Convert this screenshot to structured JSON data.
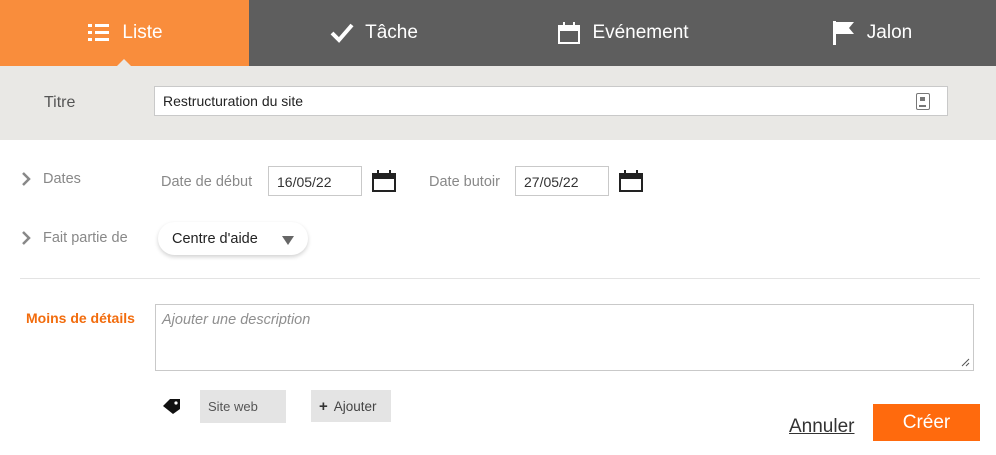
{
  "tabs": [
    {
      "label": "Liste",
      "icon": "list-icon",
      "active": true
    },
    {
      "label": "Tâche",
      "icon": "check-icon",
      "active": false
    },
    {
      "label": "Evénement",
      "icon": "calendar-icon",
      "active": false
    },
    {
      "label": "Jalon",
      "icon": "flag-icon",
      "active": false
    }
  ],
  "title": {
    "label": "Titre",
    "value": "Restructuration du site"
  },
  "dates": {
    "label": "Dates",
    "start_label": "Date de début",
    "start_value": "16/05/22",
    "due_label": "Date butoir",
    "due_value": "27/05/22"
  },
  "part_of": {
    "label": "Fait partie de",
    "selected": "Centre d'aide"
  },
  "details": {
    "toggle_label": "Moins de détails",
    "description_placeholder": "Ajouter une description"
  },
  "tags": {
    "items": [
      "Site web"
    ],
    "add_label": "Ajouter"
  },
  "actions": {
    "cancel_label": "Annuler",
    "create_label": "Créer"
  },
  "colors": {
    "accent": "#f98d3c",
    "tab_bar": "#5e5e5e",
    "create_button": "#ff6a0d",
    "less_details": "#f26c0d"
  }
}
